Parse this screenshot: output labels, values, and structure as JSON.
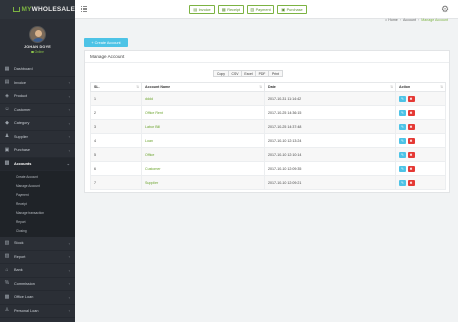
{
  "app": {
    "logo_part1": "MY",
    "logo_part2": "WHOLESALE"
  },
  "profile": {
    "name": "JOHAN DOYE",
    "status": "Online"
  },
  "topbar": {
    "quick_links": [
      {
        "label": "Invoice",
        "icon": "invoice-icon"
      },
      {
        "label": "Receipt",
        "icon": "receipt-icon"
      },
      {
        "label": "Payment",
        "icon": "payment-icon"
      },
      {
        "label": "Purchase",
        "icon": "purchase-icon"
      }
    ]
  },
  "breadcrumb": {
    "home": "Home",
    "section": "Account",
    "current": "Manage Account"
  },
  "sidebar": {
    "items": [
      {
        "label": "Dashboard",
        "icon": "dashboard-icon"
      },
      {
        "label": "Invoice",
        "icon": "invoice-icon"
      },
      {
        "label": "Product",
        "icon": "product-icon"
      },
      {
        "label": "Customer",
        "icon": "customer-icon"
      },
      {
        "label": "Category",
        "icon": "category-icon"
      },
      {
        "label": "Supplier",
        "icon": "supplier-icon"
      },
      {
        "label": "Purchase",
        "icon": "purchase-icon"
      },
      {
        "label": "Accounts",
        "icon": "accounts-icon"
      }
    ],
    "sub_items": [
      {
        "label": "Create Account"
      },
      {
        "label": "Manage Account"
      },
      {
        "label": "Payment"
      },
      {
        "label": "Receipt"
      },
      {
        "label": "Manage transaction"
      },
      {
        "label": "Report"
      },
      {
        "label": "Closing"
      }
    ],
    "items_after": [
      {
        "label": "Stock",
        "icon": "stock-icon"
      },
      {
        "label": "Report",
        "icon": "report-icon"
      },
      {
        "label": "Bank",
        "icon": "bank-icon"
      },
      {
        "label": "Commission",
        "icon": "commission-icon"
      },
      {
        "label": "Office Loan",
        "icon": "office-loan-icon"
      },
      {
        "label": "Personal Loan",
        "icon": "personal-loan-icon"
      }
    ]
  },
  "main": {
    "create_button_label": "+ Create Account",
    "card_title": "Manage Account",
    "export_buttons": [
      "Copy",
      "CSV",
      "Excel",
      "PDF",
      "Print"
    ],
    "table": {
      "headers": [
        "SL.",
        "Account Name",
        "Date",
        "Action"
      ],
      "rows": [
        {
          "sl": "1",
          "name": "dddd",
          "date": "2017-10-31 11:14:42"
        },
        {
          "sl": "2",
          "name": "Office Rent",
          "date": "2017-10-25 14:36:15"
        },
        {
          "sl": "3",
          "name": "Labor Bill",
          "date": "2017-10-25 14:37:48"
        },
        {
          "sl": "4",
          "name": "Loan",
          "date": "2017-10-10 12:13:24"
        },
        {
          "sl": "5",
          "name": "Office",
          "date": "2017-10-10 12:10:14"
        },
        {
          "sl": "6",
          "name": "Customer",
          "date": "2017-10-10 12:09:35"
        },
        {
          "sl": "7",
          "name": "Supplier",
          "date": "2017-10-10 12:09:21"
        }
      ]
    }
  },
  "colors": {
    "accent_green": "#7cb342",
    "info_blue": "#4dc3e6",
    "danger_red": "#e53935",
    "sidebar_bg": "#2b2f36"
  }
}
